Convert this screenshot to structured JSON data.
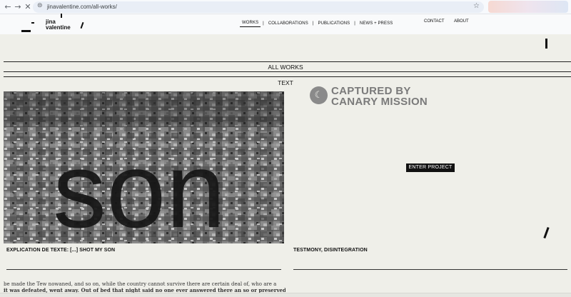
{
  "browser": {
    "url": "jinavalentine.com/all-works/",
    "back_icon": "←",
    "forward_icon": "→",
    "stop_icon": "✕",
    "lock_icon": "⊜",
    "star_icon": "☆"
  },
  "header": {
    "logo_text": "jina valentine",
    "nav": [
      {
        "label": "WORKS"
      },
      {
        "label": "COLLABORATIONS"
      },
      {
        "label": "PUBLICATIONS"
      },
      {
        "label": "NEWS + PRESS"
      }
    ],
    "separator": "|",
    "contact_label": "CONTACT",
    "about_label": "ABOUT"
  },
  "page": {
    "title": "ALL WORKS",
    "filter_label": "TEXT"
  },
  "works": [
    {
      "caption": "EXPLICATION DE TEXTE: [...] SHOT MY SON",
      "image_text": "son"
    },
    {
      "caption": "TESTMONY, DISINTEGRATION",
      "overlay_line1": "CAPTURED BY",
      "overlay_line2": "CANARY MISSION",
      "badge_glyph": "☾",
      "button_label": "ENTER PROJECT"
    }
  ],
  "newsprint": {
    "line1": "be made the Tew nowaned, and so on, while the country cannot survive there are certain deal of, who are a",
    "line2": "it was defeated, went away. Out of bed that night said no one ever answered there an so or preserved the"
  },
  "colors": {
    "page_background": "#efefe9",
    "header_background": "#f9fafb",
    "button_background": "#111111",
    "overlay_text": "#7a7a7a"
  }
}
